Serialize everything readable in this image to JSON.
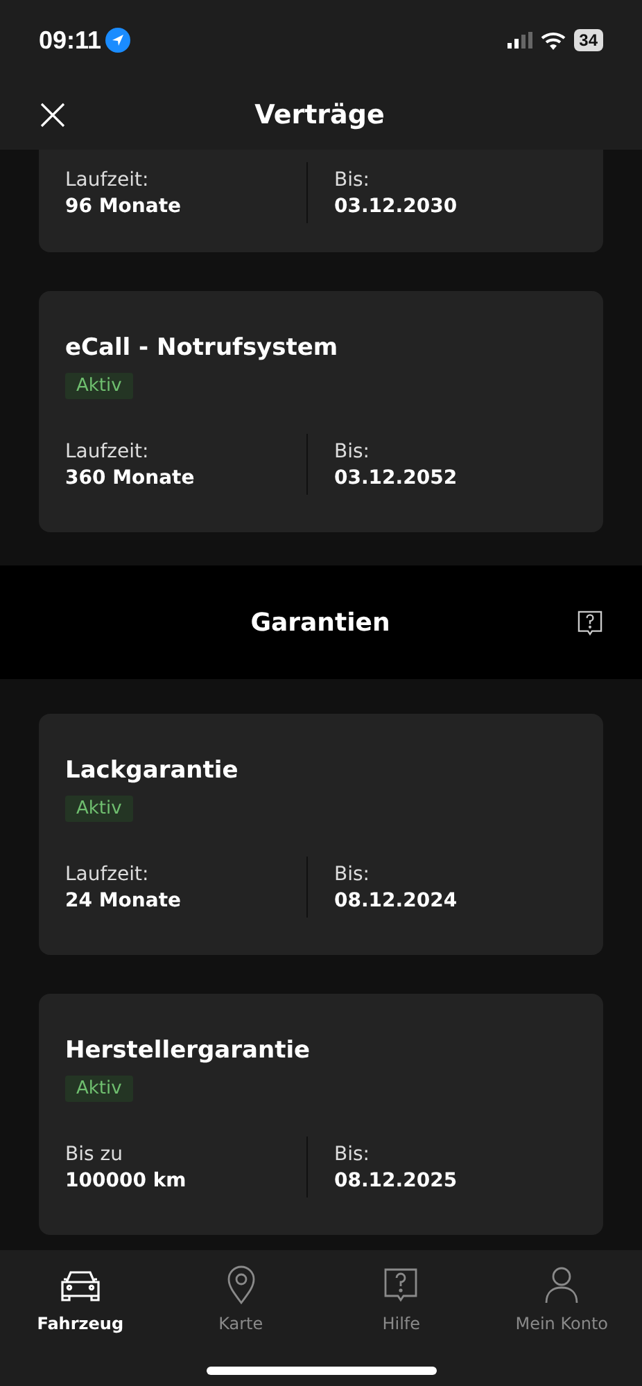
{
  "status_bar": {
    "time": "09:11",
    "battery": "34"
  },
  "header": {
    "title": "Verträge"
  },
  "contract_cards": [
    {
      "fields": [
        {
          "label": "Laufzeit:",
          "value": "96 Monate"
        },
        {
          "label": "Bis:",
          "value": "03.12.2030"
        }
      ]
    },
    {
      "title": "eCall - Notrufsystem",
      "badge": "Aktiv",
      "fields": [
        {
          "label": "Laufzeit:",
          "value": "360 Monate"
        },
        {
          "label": "Bis:",
          "value": "03.12.2052"
        }
      ]
    }
  ],
  "section": {
    "title": "Garantien"
  },
  "warranty_cards": [
    {
      "title": "Lackgarantie",
      "badge": "Aktiv",
      "fields": [
        {
          "label": "Laufzeit:",
          "value": "24 Monate"
        },
        {
          "label": "Bis:",
          "value": "08.12.2024"
        }
      ]
    },
    {
      "title": "Herstellergarantie",
      "badge": "Aktiv",
      "fields": [
        {
          "label": "Bis zu",
          "value": "100000 km"
        },
        {
          "label": "Bis:",
          "value": "08.12.2025"
        }
      ]
    }
  ],
  "tab_bar": [
    {
      "kind": "car",
      "label": "Fahrzeug",
      "selected": true
    },
    {
      "kind": "pin",
      "label": "Karte",
      "selected": false
    },
    {
      "kind": "help",
      "label": "Hilfe",
      "selected": false
    },
    {
      "kind": "person",
      "label": "Mein Konto",
      "selected": false
    }
  ]
}
